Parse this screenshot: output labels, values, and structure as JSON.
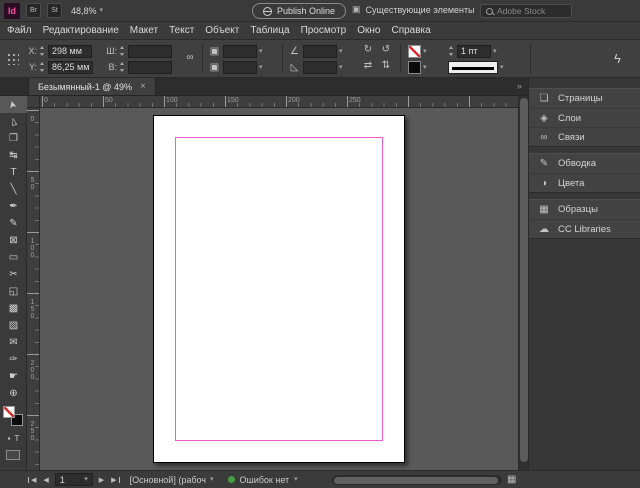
{
  "titlebar": {
    "logo": "Id",
    "bridge": "Br",
    "stock": "St",
    "zoom": "48,8%",
    "publish": "Publish Online",
    "workspace": "Существующие элементы",
    "search_placeholder": "Adobe Stock"
  },
  "menubar": {
    "items": [
      "Файл",
      "Редактирование",
      "Макет",
      "Текст",
      "Объект",
      "Таблица",
      "Просмотр",
      "Окно",
      "Справка"
    ]
  },
  "control_panel": {
    "x_label": "X:",
    "x_value": "298 мм",
    "y_label": "Y:",
    "y_value": "86,25 мм",
    "w_label": "Ш:",
    "w_value": "",
    "h_label": "В:",
    "h_value": "",
    "scale_x": "",
    "scale_y": "",
    "rotation": "",
    "shear": "",
    "stroke_weight": "1 пт"
  },
  "tabbar": {
    "document_title": "Безымянный-1 @ 49%"
  },
  "rulers": {
    "horizontal": [
      "0",
      "50",
      "100",
      "150",
      "200",
      "250"
    ],
    "vertical": [
      "0",
      "50",
      "100",
      "150",
      "200",
      "250"
    ]
  },
  "toolbar": {
    "tools": [
      {
        "name": "selection-tool",
        "glyph": "➤",
        "rot": -105,
        "active": true
      },
      {
        "name": "direct-selection-tool",
        "glyph": "▻",
        "rot": -105
      },
      {
        "name": "page-tool",
        "glyph": "❐"
      },
      {
        "name": "gap-tool",
        "glyph": "↹"
      },
      {
        "name": "type-tool",
        "glyph": "T"
      },
      {
        "name": "line-tool",
        "glyph": "╲"
      },
      {
        "name": "pen-tool",
        "glyph": "✒"
      },
      {
        "name": "pencil-tool",
        "glyph": "✎"
      },
      {
        "name": "rectangle-frame-tool",
        "glyph": "⊠"
      },
      {
        "name": "rectangle-tool",
        "glyph": "▭"
      },
      {
        "name": "scissors-tool",
        "glyph": "✂"
      },
      {
        "name": "free-transform-tool",
        "glyph": "◱"
      },
      {
        "name": "gradient-swatch-tool",
        "glyph": "▩"
      },
      {
        "name": "gradient-feather-tool",
        "glyph": "▨"
      },
      {
        "name": "note-tool",
        "glyph": "✉"
      },
      {
        "name": "eyedropper-tool",
        "glyph": "✑"
      },
      {
        "name": "hand-tool",
        "glyph": "☛"
      },
      {
        "name": "zoom-tool",
        "glyph": "⊕"
      }
    ],
    "mini": {
      "container_icon": "▪",
      "text_icon": "T"
    }
  },
  "panels": {
    "groups": [
      {
        "items": [
          {
            "label": "Страницы",
            "icon": "pages-icon",
            "glyph": "❏"
          },
          {
            "label": "Слои",
            "icon": "layers-icon",
            "glyph": "◈"
          },
          {
            "label": "Связи",
            "icon": "links-icon",
            "glyph": "∞"
          }
        ]
      },
      {
        "items": [
          {
            "label": "Обводка",
            "icon": "stroke-icon",
            "glyph": "✎"
          },
          {
            "label": "Цвета",
            "icon": "color-icon",
            "glyph": "◑"
          }
        ]
      },
      {
        "items": [
          {
            "label": "Образцы",
            "icon": "swatches-icon",
            "glyph": "▦"
          },
          {
            "label": "CC Libraries",
            "icon": "cc-libraries-icon",
            "glyph": "☁"
          }
        ]
      }
    ]
  },
  "statusbar": {
    "page_value": "1",
    "master_info": "[Основной] (рабоч",
    "preflight_label": "Ошибок нет"
  },
  "icons": {
    "chevron_down": "▾",
    "close": "×",
    "left_arrow": "◀",
    "right_arrow": "▶",
    "double_chevron": "»",
    "workspace": "▣",
    "lightning": "ϟ",
    "constrain_link": "∞",
    "scale": "▣",
    "rotate": "∠",
    "shear": "◺",
    "rotate_cw": "↻",
    "rotate_ccw": "↺",
    "flip_horizontal": "⇄",
    "flip_vertical": "⇅",
    "grid": "▦"
  },
  "colors": {
    "logo_pink": "#ff4fa0",
    "guide_magenta": "#ee5ad4",
    "preflight_green": "#43a047",
    "page_white": "#ffffff",
    "pasteboard_gray": "#595959"
  }
}
